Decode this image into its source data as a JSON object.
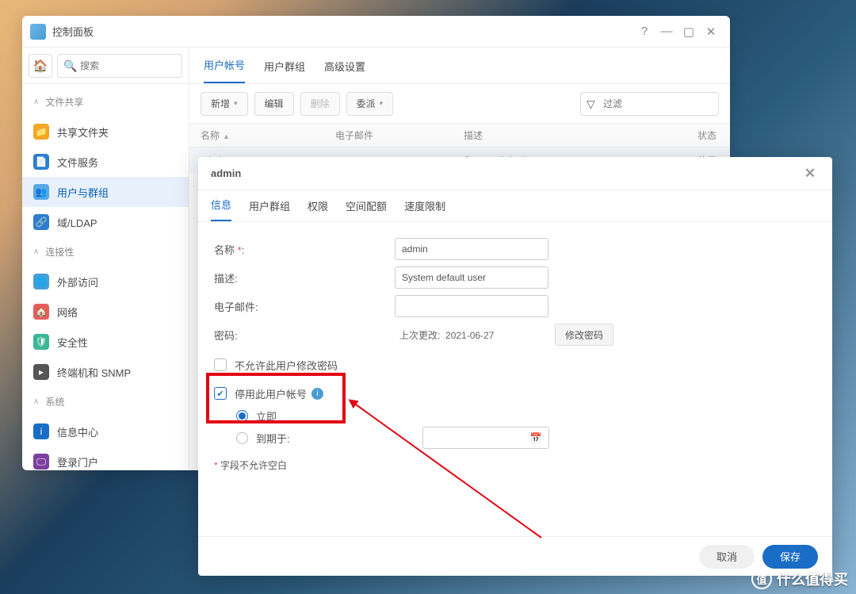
{
  "window": {
    "title": "控制面板"
  },
  "sidebar": {
    "search_placeholder": "搜索",
    "groups": {
      "file_sharing": "文件共享",
      "connectivity": "连接性",
      "system": "系统"
    },
    "items": {
      "shared_folders": "共享文件夹",
      "file_services": "文件服务",
      "users_groups": "用户与群组",
      "domain_ldap": "域/LDAP",
      "external_access": "外部访问",
      "network": "网络",
      "security": "安全性",
      "terminal_snmp": "终端机和 SNMP",
      "info_center": "信息中心",
      "login_portal": "登录门户"
    }
  },
  "tabs": {
    "user_account": "用户帐号",
    "user_group": "用户群组",
    "advanced": "高级设置"
  },
  "toolbar": {
    "new": "新增",
    "edit": "编辑",
    "delete": "删除",
    "delegate": "委派",
    "filter_placeholder": "过滤"
  },
  "table": {
    "headers": {
      "name": "名称",
      "email": "电子邮件",
      "desc": "描述",
      "status": "状态"
    },
    "rows": [
      {
        "name": "admin",
        "email": "",
        "desc": "System default user",
        "status": "停用"
      }
    ]
  },
  "modal": {
    "title": "admin",
    "tabs": {
      "info": "信息",
      "user_group": "用户群组",
      "perm": "权限",
      "quota": "空间配额",
      "speed": "速度限制"
    },
    "labels": {
      "name": "名称",
      "desc": "描述:",
      "email": "电子邮件:",
      "password": "密码:",
      "last_changed_label": "上次更改:",
      "change_password": "修改密码",
      "disallow_change_pw": "不允许此用户修改密码",
      "disable_account": "停用此用户帐号",
      "immediately": "立即",
      "expire_on": "到期于:",
      "note": "字段不允许空白"
    },
    "values": {
      "name": "admin",
      "desc": "System default user",
      "email": "",
      "last_changed": "2021-06-27"
    },
    "buttons": {
      "cancel": "取消",
      "save": "保存"
    }
  },
  "watermark": "什么值得买"
}
